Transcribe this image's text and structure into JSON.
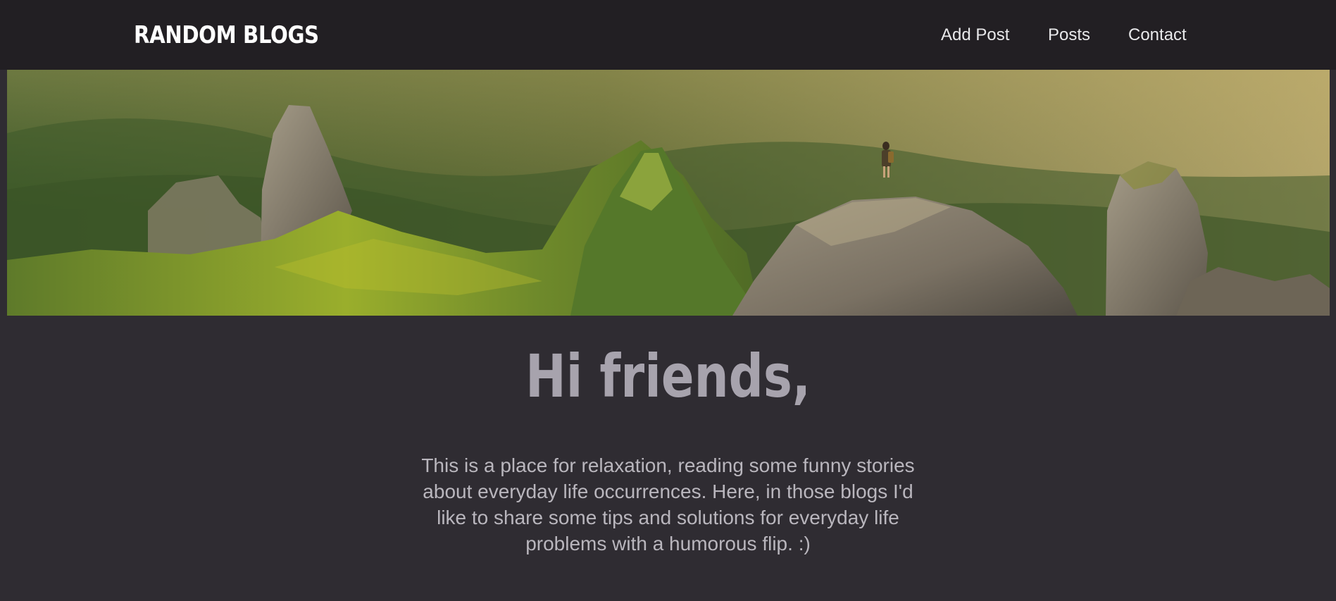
{
  "header": {
    "brand": "RANDOM BLOGS",
    "nav": [
      {
        "label": "Add Post"
      },
      {
        "label": "Posts"
      },
      {
        "label": "Contact"
      }
    ]
  },
  "hero": {
    "image": "mountain-landscape-with-hiker",
    "colors": {
      "sky_haze": "#b3a46a",
      "forest": "#3f5a2a",
      "grass": "#8aa235",
      "rock": "#7d7466"
    }
  },
  "main": {
    "headline": "Hi friends,",
    "intro": "This is a place for relaxation, reading some funny stories about everyday life occurrences. Here, in those blogs I'd like to share some tips and solutions for everyday life problems with a humorous flip. :)"
  },
  "theme": {
    "page_background": "#2f2c32",
    "navbar_background": "#221f23",
    "headline_color": "#a7a3ad",
    "body_text_color": "#b9b6bd"
  }
}
